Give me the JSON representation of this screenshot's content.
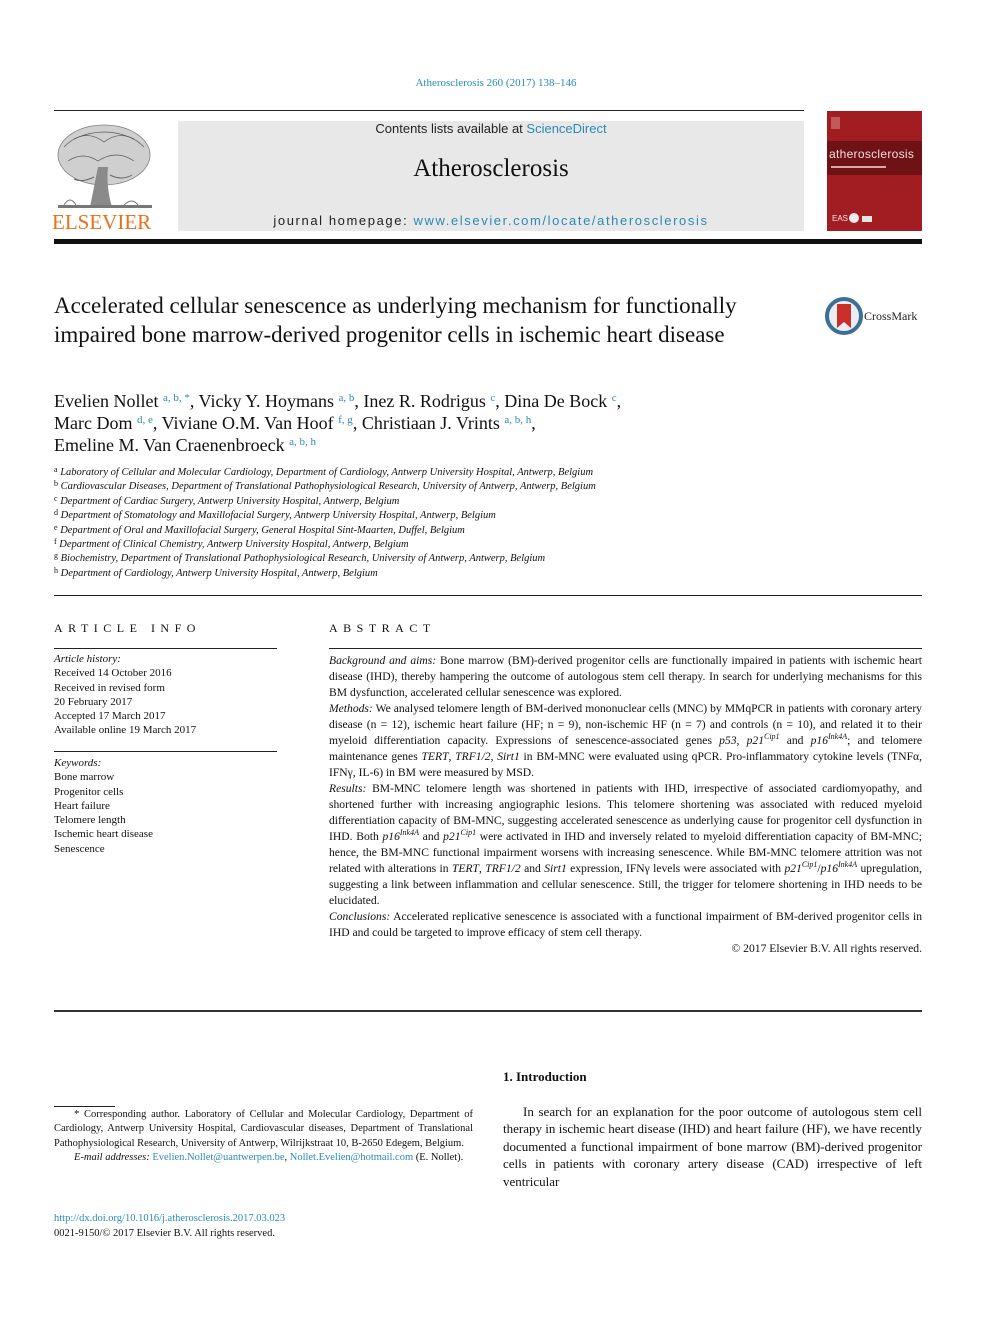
{
  "header": {
    "citation": "Atherosclerosis 260 (2017) 138–146",
    "contents_prefix": "Contents lists available at ",
    "contents_link": "ScienceDirect",
    "journal_title": "Atherosclerosis",
    "homepage_prefix": "journal homepage: ",
    "homepage_link": "www.elsevier.com/locate/atherosclerosis",
    "publisher_logo_text": "ELSEVIER",
    "publisher_logo_icon": "elsevier-tree-icon",
    "cover_title": "atherosclerosis",
    "cover_footer": "EAS",
    "colors": {
      "link": "#2a8ab5",
      "elsevier_orange": "#e9711c",
      "cover_red": "#a21d22",
      "masthead_gray": "#e8e8e8"
    }
  },
  "article": {
    "title": "Accelerated cellular senescence as underlying mechanism for functionally impaired bone marrow-derived progenitor cells in ischemic heart disease",
    "crossmark_label": "CrossMark",
    "authors": [
      {
        "name": "Evelien Nollet",
        "aff": "a, b, *",
        "sep": ", "
      },
      {
        "name": "Vicky Y. Hoymans",
        "aff": "a, b",
        "sep": ", "
      },
      {
        "name": "Inez R. Rodrigus",
        "aff": "c",
        "sep": ", "
      },
      {
        "name": "Dina De Bock",
        "aff": "c",
        "sep": ","
      },
      {
        "name": "Marc Dom",
        "aff": "d, e",
        "sep": ", "
      },
      {
        "name": "Viviane O.M. Van Hoof",
        "aff": "f, g",
        "sep": ", "
      },
      {
        "name": "Christiaan J. Vrints",
        "aff": "a, b, h",
        "sep": ","
      },
      {
        "name": "Emeline M. Van Craenenbroeck",
        "aff": "a, b, h",
        "sep": ""
      }
    ],
    "affiliations": [
      {
        "key": "a",
        "text": "Laboratory of Cellular and Molecular Cardiology, Department of Cardiology, Antwerp University Hospital, Antwerp, Belgium"
      },
      {
        "key": "b",
        "text": "Cardiovascular Diseases, Department of Translational Pathophysiological Research, University of Antwerp, Antwerp, Belgium"
      },
      {
        "key": "c",
        "text": "Department of Cardiac Surgery, Antwerp University Hospital, Antwerp, Belgium"
      },
      {
        "key": "d",
        "text": "Department of Stomatology and Maxillofacial Surgery, Antwerp University Hospital, Antwerp, Belgium"
      },
      {
        "key": "e",
        "text": "Department of Oral and Maxillofacial Surgery, General Hospital Sint-Maarten, Duffel, Belgium"
      },
      {
        "key": "f",
        "text": "Department of Clinical Chemistry, Antwerp University Hospital, Antwerp, Belgium"
      },
      {
        "key": "g",
        "text": "Biochemistry, Department of Translational Pathophysiological Research, University of Antwerp, Antwerp, Belgium"
      },
      {
        "key": "h",
        "text": "Department of Cardiology, Antwerp University Hospital, Antwerp, Belgium"
      }
    ]
  },
  "article_info": {
    "heading": "ARTICLE INFO",
    "history_label": "Article history:",
    "history": [
      "Received 14 October 2016",
      "Received in revised form",
      "20 February 2017",
      "Accepted 17 March 2017",
      "Available online 19 March 2017"
    ],
    "keywords_label": "Keywords:",
    "keywords": [
      "Bone marrow",
      "Progenitor cells",
      "Heart failure",
      "Telomere length",
      "Ischemic heart disease",
      "Senescence"
    ]
  },
  "abstract": {
    "heading": "ABSTRACT",
    "background_label": "Background and aims:",
    "background_text": "Bone marrow (BM)-derived progenitor cells are functionally impaired in patients with ischemic heart disease (IHD), thereby hampering the outcome of autologous stem cell therapy. In search for underlying mechanisms for this BM dysfunction, accelerated cellular senescence was explored.",
    "methods_label": "Methods:",
    "methods_parts": {
      "t1": "We analysed telomere length of BM-derived mononuclear cells (MNC) by MMqPCR in patients with coronary artery disease (n = 12), ischemic heart failure (HF; n = 9), non-ischemic HF (n = 7) and controls (n = 10), and related it to their myeloid differentiation capacity. Expressions of senescence-associated genes ",
      "g1": "p53",
      "t2": ", ",
      "g2": "p21",
      "g2sup": "Cip1",
      "t3": " and ",
      "g3": "p16",
      "g3sup": "Ink4A",
      "t4": "; and telomere maintenance genes ",
      "g4": "TERT",
      "t5": ", ",
      "g5": "TRF1/2",
      "t6": ", ",
      "g6": "Sirt1",
      "t7": " in BM-MNC were evaluated using qPCR. Pro-inflammatory cytokine levels (TNFα, IFNγ, IL-6) in BM were measured by MSD."
    },
    "results_label": "Results:",
    "results_parts": {
      "t1": "BM-MNC telomere length was shortened in patients with IHD, irrespective of associated cardiomyopathy, and shortened further with increasing angiographic lesions. This telomere shortening was associated with reduced myeloid differentiation capacity of BM-MNC, suggesting accelerated senescence as underlying cause for progenitor cell dysfunction in IHD. Both ",
      "g1": "p16",
      "g1sup": "Ink4A",
      "t2": " and ",
      "g2": "p21",
      "g2sup": "Cip1",
      "t3": " were activated in IHD and inversely related to myeloid differentiation capacity of BM-MNC; hence, the BM-MNC functional impairment worsens with increasing senescence. While BM-MNC telomere attrition was not related with alterations in ",
      "g3": "TERT",
      "t4": ", ",
      "g4": "TRF1/2",
      "t5": " and ",
      "g5": "Sirt1",
      "t6": " expression, IFNγ levels were associated with ",
      "g6": "p21",
      "g6sup": "Cip1",
      "t7": "/",
      "g7": "p16",
      "g7sup": "Ink4A",
      "t8": " upregulation, suggesting a link between inflammation and cellular senescence. Still, the trigger for telomere shortening in IHD needs to be elucidated."
    },
    "conclusions_label": "Conclusions:",
    "conclusions_text": "Accelerated replicative senescence is associated with a functional impairment of BM-derived progenitor cells in IHD and could be targeted to improve efficacy of stem cell therapy.",
    "copyright": "© 2017 Elsevier B.V. All rights reserved."
  },
  "footnote": {
    "corresponding": "* Corresponding author. Laboratory of Cellular and Molecular Cardiology, Department of Cardiology, Antwerp University Hospital, Cardiovascular diseases, Department of Translational Pathophysiological Research, University of Antwerp, Wilrijkstraat 10, B-2650 Edegem, Belgium.",
    "email_label": "E-mail addresses:",
    "email1": "Evelien.Nollet@uantwerpen.be",
    "email2": "Nollet.Evelien@hotmail.com",
    "email_owner": "(E. Nollet).",
    "doi": "http://dx.doi.org/10.1016/j.atherosclerosis.2017.03.023",
    "issn": "0021-9150/© 2017 Elsevier B.V. All rights reserved."
  },
  "introduction": {
    "heading": "1.  Introduction",
    "text": "In search for an explanation for the poor outcome of autologous stem cell therapy in ischemic heart disease (IHD) and heart failure (HF), we have recently documented a functional impairment of bone marrow (BM)-derived progenitor cells in patients with coronary artery disease (CAD) irrespective of left ventricular"
  }
}
